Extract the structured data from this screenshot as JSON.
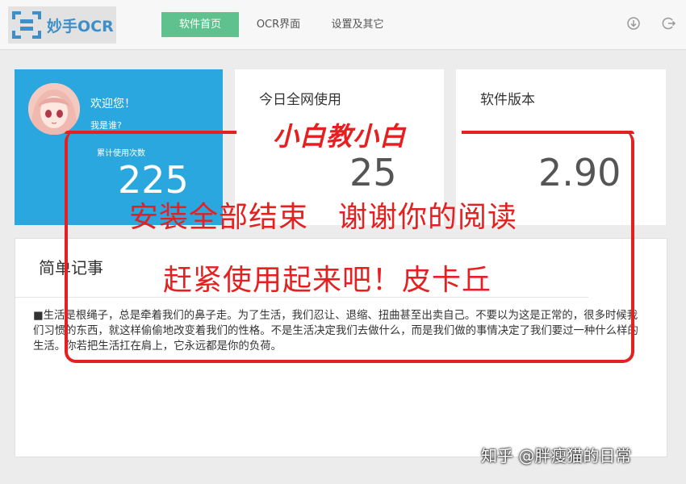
{
  "app": {
    "title": "妙手OCR"
  },
  "nav": {
    "tabs": [
      {
        "label": "软件首页"
      },
      {
        "label": "OCR界面"
      },
      {
        "label": "设置及其它"
      }
    ]
  },
  "toolbar": {
    "download_icon": "download-icon",
    "logout_icon": "logout-icon"
  },
  "user_card": {
    "welcome": "欢迎您！",
    "who": "我是谁?",
    "count_label": "累计使用次数",
    "count": "225"
  },
  "today_card": {
    "title": "今日全网使用",
    "value": "25"
  },
  "version_card": {
    "title": "软件版本",
    "value": "2.90"
  },
  "notes": {
    "title": "简单记事",
    "body": "■生活是根绳子，总是牵着我们的鼻子走。为了生活，我们忍让、退缩、扭曲甚至出卖自己。不要以为这是正常的，很多时候我们习惯的东西，就这样偷偷地改变着我们的性格。不是生活决定我们去做什么，而是我们做的事情决定了我们要过一种什么样的生活。你若把生活扛在肩上，它永远都是你的负荷。"
  },
  "overlay": {
    "label": "小白教小白",
    "line1": "安装全部结束　谢谢你的阅读",
    "line2": "赶紧使用起来吧！皮卡丘",
    "watermark": "知乎 @胖瘦猫的日常"
  },
  "colors": {
    "accent_green": "#5fc28e",
    "card_blue": "#2aa7de",
    "annotation_red": "#e52020",
    "logo_blue": "#3d8fc9"
  }
}
